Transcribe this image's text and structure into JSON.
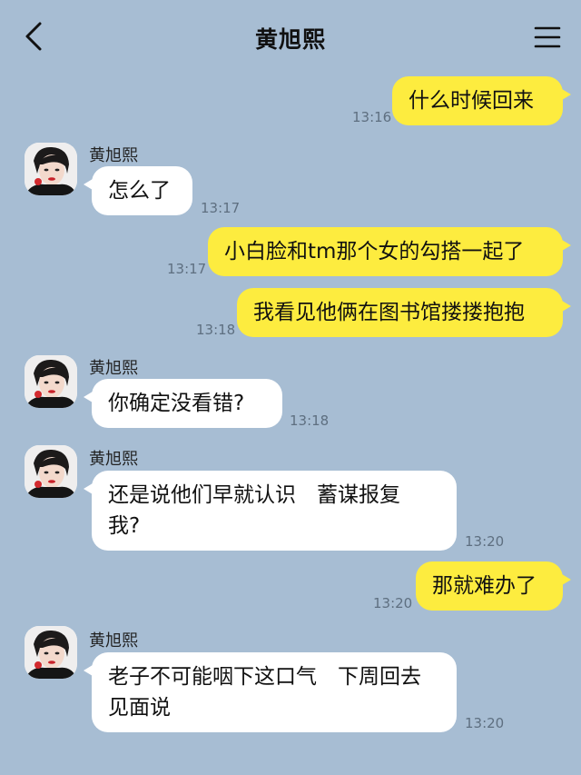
{
  "header": {
    "title": "黄旭熙"
  },
  "messages": [
    {
      "side": "right",
      "text": "什么时候回来",
      "time": "13:16"
    },
    {
      "side": "left",
      "sender": "黄旭熙",
      "text": "怎么了",
      "time": "13:17"
    },
    {
      "side": "right",
      "text": "小白脸和tm那个女的勾搭一起了",
      "time": "13:17"
    },
    {
      "side": "right",
      "text": "我看见他俩在图书馆搂搂抱抱",
      "time": "13:18"
    },
    {
      "side": "left",
      "sender": "黄旭熙",
      "text": "你确定没看错?",
      "time": "13:18"
    },
    {
      "side": "left",
      "sender": "黄旭熙",
      "line1": "还是说他们早就认识　蓄谋报复",
      "line2": "我?",
      "time": "13:20"
    },
    {
      "side": "right",
      "text": "那就难办了",
      "time": "13:20"
    },
    {
      "side": "left",
      "sender": "黄旭熙",
      "line1": "老子不可能咽下这口气　下周回去",
      "line2": "见面说",
      "time": "13:20"
    }
  ],
  "colors": {
    "background": "#a7bdd3",
    "my_bubble": "#fdec3f",
    "their_bubble": "#ffffff"
  },
  "icons": {
    "back": "chevron-left-icon",
    "menu": "hamburger-menu-icon",
    "avatar": "contact-avatar"
  }
}
